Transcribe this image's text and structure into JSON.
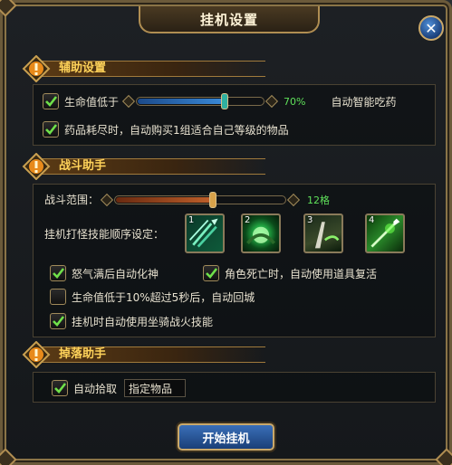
{
  "window": {
    "title": "挂机设置"
  },
  "sections": {
    "assist": {
      "title": "辅助设置",
      "hp_label": "生命值低于",
      "hp_value": "70%",
      "hp_fraction": 0.7,
      "hp_action": "自动智能吃药",
      "hp_checked": true,
      "potion_label": "药品耗尽时，自动购买1组适合自己等级的物品",
      "potion_checked": true
    },
    "combat": {
      "title": "战斗助手",
      "range_label": "战斗范围：",
      "range_value": "12格",
      "range_fraction": 0.58,
      "skill_order_label": "挂机打怪技能顺序设定：",
      "skills": [
        {
          "num": "1",
          "icon": "triple-arrow-skill-icon"
        },
        {
          "num": "2",
          "icon": "green-burst-skill-icon"
        },
        {
          "num": "3",
          "icon": "blade-slash-skill-icon"
        },
        {
          "num": "4",
          "icon": "green-spear-skill-icon"
        }
      ],
      "rage_label": "怒气满后自动化神",
      "rage_checked": true,
      "revive_label": "角色死亡时，自动使用道具复活",
      "revive_checked": true,
      "return_label": "生命值低于10%超过5秒后，自动回城",
      "return_checked": false,
      "mount_label": "挂机时自动使用坐骑战火技能",
      "mount_checked": true
    },
    "loot": {
      "title": "掉落助手",
      "auto_pickup_label": "自动拾取",
      "auto_pickup_checked": true,
      "item_input_value": "指定物品"
    }
  },
  "start_button_label": "开始挂机",
  "colors": {
    "accent_gold": "#ffd35a",
    "value_green": "#5fe05a",
    "button_blue": "#2a5aa0"
  }
}
